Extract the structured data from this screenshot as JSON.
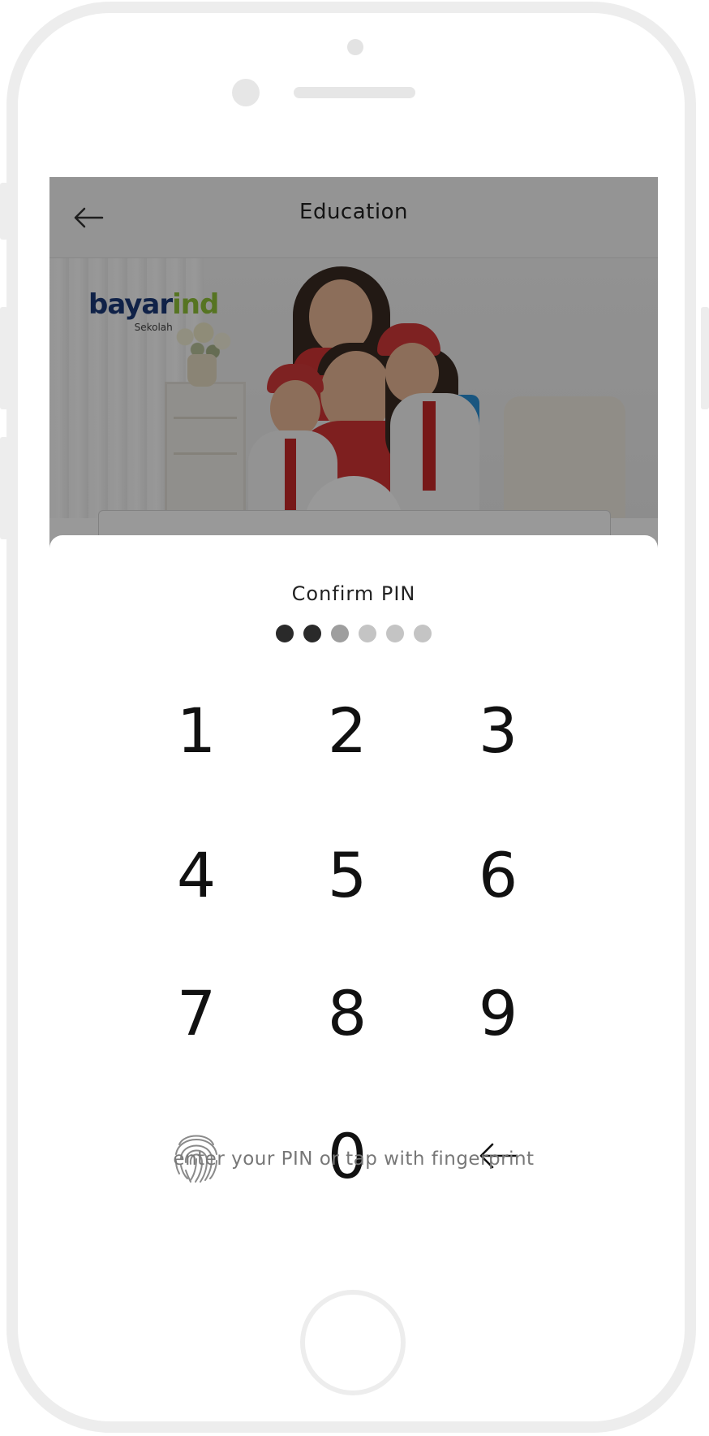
{
  "header": {
    "title": "Education"
  },
  "banner": {
    "logo_main": "bayar",
    "logo_accent": "ind",
    "logo_sub": "Sekolah",
    "circle_logo_main": "bayar",
    "circle_logo_accent": "ind"
  },
  "pin_sheet": {
    "title": "Confirm PIN",
    "pin_length": 6,
    "filled_count": 2,
    "keys": [
      "1",
      "2",
      "3",
      "4",
      "5",
      "6",
      "7",
      "8",
      "9",
      "0"
    ],
    "hint": "enter your PIN or tap with fingerprint"
  },
  "icons": {
    "back": "arrow-left-icon",
    "fingerprint": "fingerprint-icon",
    "delete": "backspace-arrow-icon"
  },
  "colors": {
    "brand_blue": "#1b3a78",
    "brand_green": "#8fc13a",
    "pin_dot_filled": "#2a2a2a",
    "pin_dot_empty": "#c4c4c4"
  }
}
